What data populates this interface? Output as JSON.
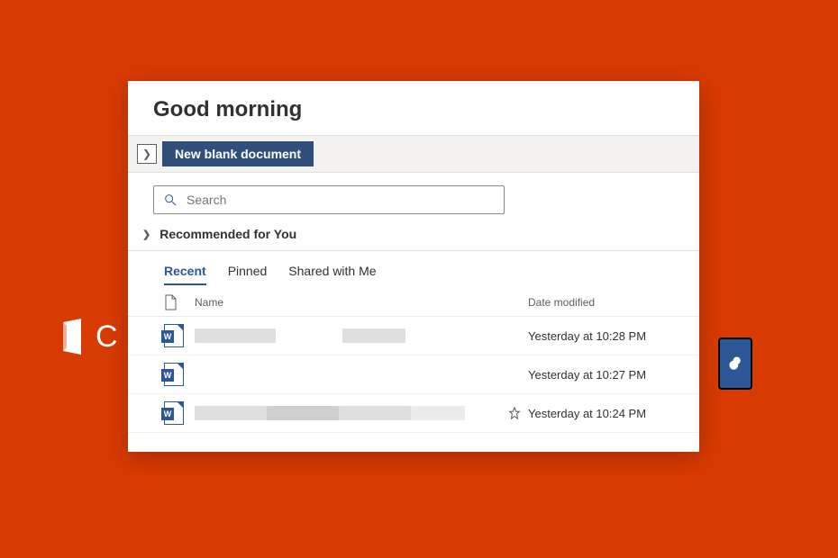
{
  "greeting": "Good morning",
  "toolbar": {
    "new_doc_label": "New blank document"
  },
  "search": {
    "placeholder": "Search"
  },
  "sections": {
    "recommended_label": "Recommended for You"
  },
  "tabs": [
    {
      "label": "Recent",
      "active": true
    },
    {
      "label": "Pinned",
      "active": false
    },
    {
      "label": "Shared with Me",
      "active": false
    }
  ],
  "columns": {
    "name": "Name",
    "date": "Date modified"
  },
  "files": [
    {
      "name": "",
      "date": "Yesterday at 10:28 PM",
      "pinned": false
    },
    {
      "name": "",
      "date": "Yesterday at 10:27 PM",
      "pinned": false
    },
    {
      "name": "",
      "date": "Yesterday at 10:24 PM",
      "pinned": true
    }
  ],
  "background": {
    "office_letter": "C"
  }
}
